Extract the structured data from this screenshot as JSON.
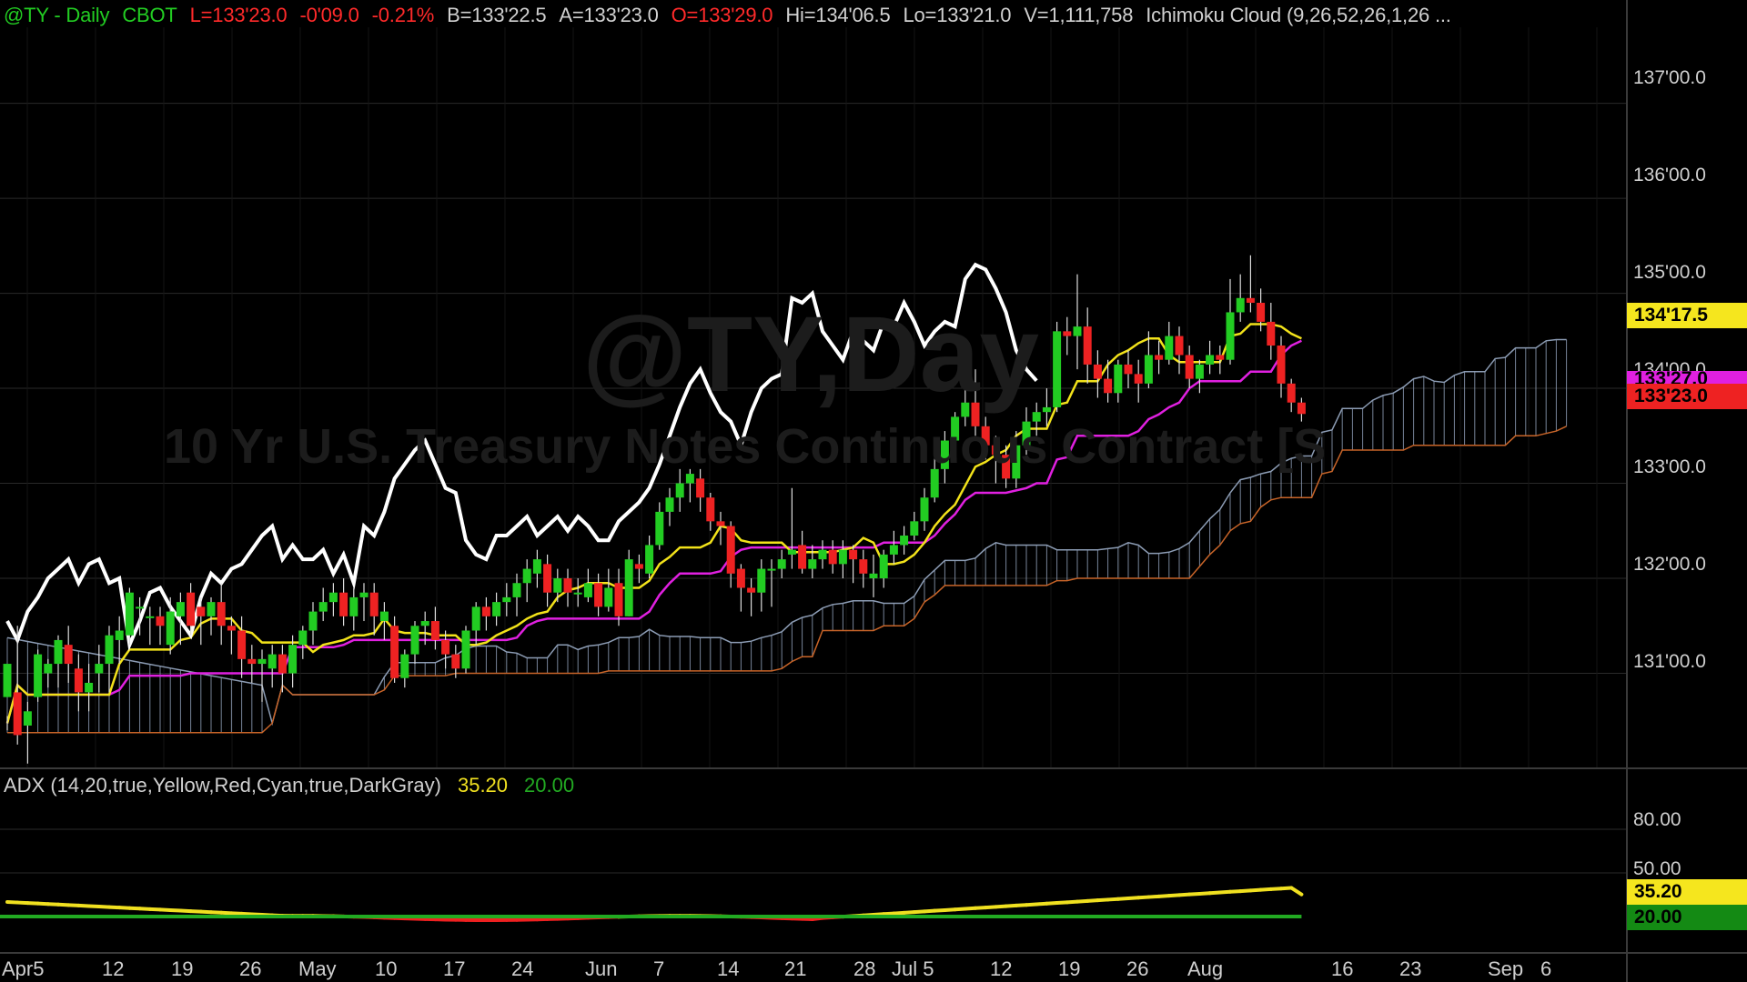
{
  "header": {
    "symbol": "@TY - Daily",
    "exchange": "CBOT",
    "last": "L=133'23.0",
    "change": "-0'09.0",
    "pct": "-0.21%",
    "bid": "B=133'22.5",
    "ask": "A=133'23.0",
    "open": "O=133'29.0",
    "high": "Hi=134'06.5",
    "low": "Lo=133'21.0",
    "volume": "V=1,111,758",
    "study": "Ichimoku Cloud (9,26,52,26,1,26 ..."
  },
  "watermark": {
    "symbol": "@TY,Day",
    "description": "10 Yr U.S. Treasury Notes Continuous Contract [S"
  },
  "adx_header": {
    "label": "ADX (14,20,true,Yellow,Red,Cyan,true,DarkGray)",
    "adx_value": "35.20",
    "threshold_value": "20.00"
  },
  "price_axis": {
    "labels": [
      "137'00.0",
      "136'00.0",
      "135'00.0",
      "134'00.0",
      "133'00.0",
      "132'00.0",
      "131'00.0"
    ],
    "values": [
      137,
      136,
      135,
      134,
      133,
      132,
      131
    ]
  },
  "adx_axis": {
    "labels": [
      "80.00",
      "50.00"
    ],
    "values": [
      80,
      50
    ]
  },
  "tags": {
    "kijun": "134'17.5",
    "senkou": "133'27.0",
    "last": "133'23.0",
    "adx": "35.20",
    "threshold": "20.00"
  },
  "time_axis": [
    "Apr5",
    "12",
    "19",
    "26",
    "May",
    "10",
    "17",
    "24",
    "Jun",
    "7",
    "14",
    "21",
    "28",
    "Jul 5",
    "12",
    "19",
    "26",
    "Aug",
    "16",
    "23",
    "Sep",
    "6"
  ],
  "colors": {
    "background": "#000000",
    "up_candle": "#22cc22",
    "down_candle": "#ee2222",
    "tenkan": "#f2e21a",
    "kijun": "#e020e0",
    "chikou": "#ffffff",
    "cloud_bear": "#c86428",
    "cloud_bull": "#8c9cb4",
    "adx_high": "#f0e020",
    "adx_low": "#ee2020",
    "threshold": "#22aa22"
  },
  "chart_data": {
    "type": "candlestick",
    "timeframe": "Daily",
    "x_labels": [
      "Apr5",
      "12",
      "19",
      "26",
      "May",
      "10",
      "17",
      "24",
      "Jun",
      "7",
      "14",
      "21",
      "28",
      "Jul 5",
      "12",
      "19",
      "26",
      "Aug",
      "16",
      "23",
      "Sep",
      "6"
    ],
    "ylim": [
      130.0,
      137.8
    ],
    "adx_ylim": [
      0,
      100
    ],
    "candles": [
      [
        130.75,
        131.1,
        130.55,
        130.4
      ],
      [
        130.8,
        130.35,
        131.5,
        130.25
      ],
      [
        130.45,
        130.6,
        130.7,
        130.05
      ],
      [
        130.75,
        131.2,
        131.25,
        130.7
      ],
      [
        131.0,
        131.1,
        131.15,
        130.85
      ],
      [
        131.1,
        131.35,
        131.4,
        130.85
      ],
      [
        131.3,
        131.1,
        131.5,
        130.9
      ],
      [
        131.05,
        130.8,
        131.2,
        130.6
      ],
      [
        130.8,
        130.9,
        131.1,
        130.6
      ],
      [
        131.0,
        131.1,
        131.3,
        130.8
      ],
      [
        131.1,
        131.4,
        131.5,
        130.8
      ],
      [
        131.35,
        131.45,
        131.6,
        131.1
      ],
      [
        131.4,
        131.85,
        131.9,
        131.3
      ],
      [
        131.7,
        131.7,
        131.8,
        131.4
      ],
      [
        131.6,
        131.6,
        131.7,
        131.3
      ],
      [
        131.6,
        131.5,
        131.7,
        131.3
      ],
      [
        131.3,
        131.65,
        131.8,
        131.2
      ],
      [
        131.6,
        131.75,
        131.85,
        131.3
      ],
      [
        131.85,
        131.5,
        131.95,
        131.4
      ],
      [
        131.7,
        131.6,
        131.8,
        131.3
      ],
      [
        131.6,
        131.75,
        131.8,
        131.4
      ],
      [
        131.75,
        131.5,
        131.95,
        131.3
      ],
      [
        131.5,
        131.45,
        131.6,
        131.2
      ],
      [
        131.45,
        131.15,
        131.6,
        130.95
      ],
      [
        131.15,
        131.1,
        131.3,
        130.9
      ],
      [
        131.1,
        131.15,
        131.25,
        130.7
      ],
      [
        131.05,
        131.2,
        131.3,
        130.85
      ],
      [
        131.2,
        131.0,
        131.3,
        130.8
      ],
      [
        131.0,
        131.3,
        131.4,
        130.85
      ],
      [
        131.3,
        131.45,
        131.5,
        131.15
      ],
      [
        131.45,
        131.65,
        131.75,
        131.3
      ],
      [
        131.65,
        131.75,
        131.9,
        131.55
      ],
      [
        131.75,
        131.85,
        131.95,
        131.6
      ],
      [
        131.85,
        131.6,
        132.0,
        131.5
      ],
      [
        131.6,
        131.8,
        131.9,
        131.45
      ],
      [
        131.8,
        131.85,
        131.95,
        131.55
      ],
      [
        131.85,
        131.6,
        131.95,
        131.4
      ],
      [
        131.55,
        131.65,
        131.75,
        131.35
      ],
      [
        131.5,
        130.95,
        131.6,
        130.9
      ],
      [
        130.95,
        131.2,
        131.25,
        130.85
      ],
      [
        131.2,
        131.5,
        131.55,
        131.1
      ],
      [
        131.5,
        131.55,
        131.65,
        131.3
      ],
      [
        131.55,
        131.35,
        131.7,
        131.25
      ],
      [
        131.35,
        131.2,
        131.45,
        131.05
      ],
      [
        131.2,
        131.05,
        131.3,
        130.95
      ],
      [
        131.05,
        131.45,
        131.5,
        131.0
      ],
      [
        131.45,
        131.7,
        131.75,
        131.3
      ],
      [
        131.7,
        131.6,
        131.8,
        131.45
      ],
      [
        131.6,
        131.75,
        131.85,
        131.5
      ],
      [
        131.75,
        131.8,
        131.95,
        131.6
      ],
      [
        131.8,
        131.95,
        132.05,
        131.6
      ],
      [
        131.95,
        132.1,
        132.2,
        131.75
      ],
      [
        132.05,
        132.2,
        132.3,
        131.9
      ],
      [
        132.15,
        131.85,
        132.25,
        131.7
      ],
      [
        131.85,
        132.0,
        132.1,
        131.75
      ],
      [
        132.0,
        131.85,
        132.1,
        131.7
      ],
      [
        131.85,
        131.85,
        132.0,
        131.7
      ],
      [
        131.8,
        131.95,
        132.1,
        131.75
      ],
      [
        131.95,
        131.7,
        132.05,
        131.6
      ],
      [
        131.7,
        131.9,
        132.1,
        131.65
      ],
      [
        131.95,
        131.6,
        132.1,
        131.5
      ],
      [
        131.6,
        132.2,
        132.3,
        131.6
      ],
      [
        132.15,
        132.1,
        132.25,
        131.95
      ],
      [
        132.05,
        132.35,
        132.45,
        132.0
      ],
      [
        132.35,
        132.7,
        132.8,
        132.3
      ],
      [
        132.7,
        132.85,
        132.95,
        132.55
      ],
      [
        132.85,
        133.0,
        133.15,
        132.7
      ],
      [
        133.0,
        133.1,
        133.15,
        132.8
      ],
      [
        133.05,
        132.85,
        133.15,
        132.7
      ],
      [
        132.85,
        132.6,
        132.9,
        132.5
      ],
      [
        132.6,
        132.55,
        132.7,
        132.35
      ],
      [
        132.55,
        132.05,
        132.6,
        131.9
      ],
      [
        132.1,
        131.9,
        132.15,
        131.65
      ],
      [
        131.9,
        131.85,
        132.0,
        131.6
      ],
      [
        131.85,
        132.1,
        132.2,
        131.65
      ],
      [
        132.1,
        132.1,
        132.2,
        131.7
      ],
      [
        132.1,
        132.2,
        132.3,
        132.0
      ],
      [
        132.25,
        132.3,
        132.95,
        132.1
      ],
      [
        132.35,
        132.1,
        132.5,
        132.05
      ],
      [
        132.1,
        132.2,
        132.35,
        132.0
      ],
      [
        132.2,
        132.3,
        132.4,
        132.1
      ],
      [
        132.3,
        132.15,
        132.4,
        132.05
      ],
      [
        132.15,
        132.3,
        132.4,
        132.0
      ],
      [
        132.3,
        132.2,
        132.35,
        131.95
      ],
      [
        132.2,
        132.05,
        132.3,
        131.9
      ],
      [
        132.0,
        132.05,
        132.25,
        131.8
      ],
      [
        132.0,
        132.25,
        132.3,
        131.9
      ],
      [
        132.25,
        132.35,
        132.5,
        132.15
      ],
      [
        132.35,
        132.45,
        132.55,
        132.25
      ],
      [
        132.45,
        132.6,
        132.7,
        132.4
      ],
      [
        132.6,
        132.85,
        132.95,
        132.5
      ],
      [
        132.85,
        133.15,
        133.3,
        132.8
      ],
      [
        133.15,
        133.45,
        133.55,
        133.0
      ],
      [
        133.45,
        133.7,
        133.75,
        133.3
      ],
      [
        133.7,
        133.85,
        134.05,
        133.6
      ],
      [
        133.85,
        133.6,
        134.2,
        133.5
      ],
      [
        133.6,
        133.4,
        133.7,
        133.25
      ],
      [
        133.4,
        133.3,
        133.5,
        133.0
      ],
      [
        133.3,
        133.05,
        133.4,
        132.95
      ],
      [
        133.05,
        133.4,
        133.55,
        132.95
      ],
      [
        133.4,
        133.65,
        133.8,
        133.3
      ],
      [
        133.65,
        133.75,
        133.85,
        133.5
      ],
      [
        133.75,
        133.8,
        134.0,
        133.6
      ],
      [
        133.8,
        134.6,
        134.7,
        133.75
      ],
      [
        134.6,
        134.55,
        134.75,
        134.35
      ],
      [
        134.55,
        134.65,
        135.2,
        134.2
      ],
      [
        134.65,
        134.25,
        134.85,
        134.05
      ],
      [
        134.25,
        134.1,
        134.4,
        133.9
      ],
      [
        134.1,
        133.95,
        134.3,
        133.85
      ],
      [
        133.95,
        134.25,
        134.3,
        133.85
      ],
      [
        134.25,
        134.15,
        134.4,
        134.0
      ],
      [
        134.15,
        134.05,
        134.3,
        133.85
      ],
      [
        134.05,
        134.35,
        134.6,
        134.0
      ],
      [
        134.35,
        134.3,
        134.5,
        134.15
      ],
      [
        134.3,
        134.55,
        134.7,
        134.25
      ],
      [
        134.55,
        134.35,
        134.65,
        134.15
      ],
      [
        134.35,
        134.1,
        134.45,
        134.0
      ],
      [
        134.1,
        134.25,
        134.3,
        133.95
      ],
      [
        134.25,
        134.35,
        134.5,
        134.15
      ],
      [
        134.35,
        134.3,
        134.45,
        134.15
      ],
      [
        134.3,
        134.8,
        135.15,
        134.25
      ],
      [
        134.8,
        134.95,
        135.2,
        134.7
      ],
      [
        134.95,
        134.9,
        135.4,
        134.8
      ],
      [
        134.9,
        134.7,
        135.05,
        134.6
      ],
      [
        134.7,
        134.45,
        134.9,
        134.3
      ],
      [
        134.45,
        134.05,
        134.55,
        133.9
      ],
      [
        134.05,
        133.85,
        134.1,
        133.75
      ],
      [
        133.85,
        133.73,
        133.9,
        133.65
      ]
    ],
    "adx_last": 35.2,
    "adx_threshold": 20.0
  }
}
